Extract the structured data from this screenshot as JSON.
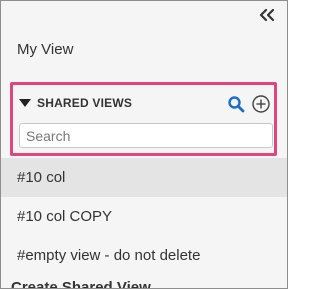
{
  "panel": {
    "my_view_label": "My View"
  },
  "shared_views": {
    "title": "SHARED VIEWS",
    "search_placeholder": "Search",
    "search_value": ""
  },
  "views": [
    {
      "label": "#10 col",
      "selected": true
    },
    {
      "label": "#10 col COPY",
      "selected": false
    },
    {
      "label": "#empty view - do not delete",
      "selected": false
    }
  ],
  "cutoff_text": "Create Shared View",
  "colors": {
    "highlight_border": "#e0457b",
    "icon_blue": "#1a6fc9",
    "selected_row": "#e4e4e4",
    "panel_bg": "#f5f5f5"
  },
  "icons": {
    "collapse": "double-chevron-left-icon",
    "caret": "caret-down-icon",
    "search": "search-icon",
    "add": "plus-circle-icon"
  }
}
